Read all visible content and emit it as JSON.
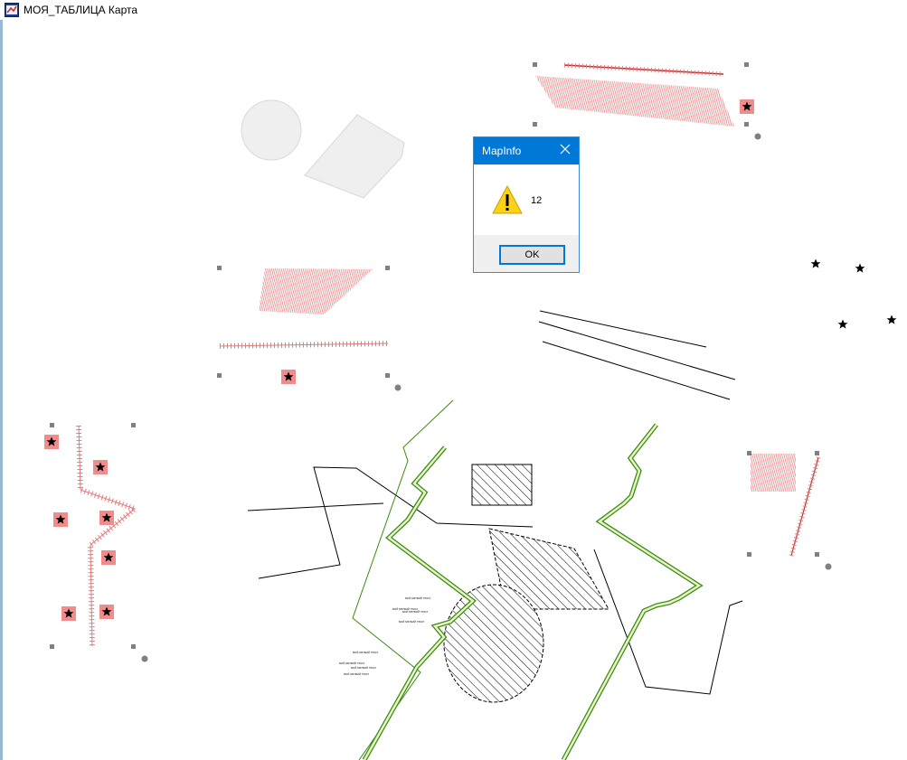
{
  "window": {
    "title": "МОЯ_ТАБЛИЦА Карта",
    "icon": "map-window-icon"
  },
  "map": {
    "labels": [
      "мой мелкий текст",
      "мой мелкий текст",
      "мой мелкий текст",
      "мой мелкий текст",
      "мой мелкий текст",
      "мой мелкий текст",
      "мой мелкий текст",
      "мой мелкий текст"
    ]
  },
  "dialog": {
    "title": "MapInfo",
    "message": "12",
    "ok_label": "OK",
    "icon": "warning-icon",
    "close_icon": "close-icon"
  },
  "colors": {
    "selection_fill": "#f08c8c",
    "hatch_red": "#e87a7a",
    "green_line": "#3a8a10",
    "dialog_accent": "#0078d7"
  }
}
